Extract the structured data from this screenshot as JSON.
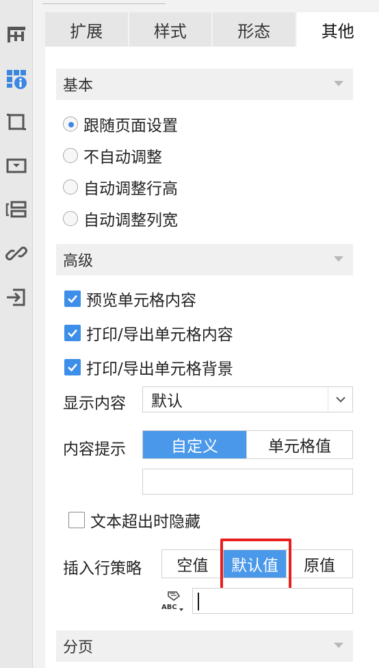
{
  "tabs": [
    {
      "label": "扩展"
    },
    {
      "label": "样式"
    },
    {
      "label": "形态"
    },
    {
      "label": "其他"
    }
  ],
  "sections": {
    "basic": "基本",
    "advanced": "高级",
    "pagination": "分页"
  },
  "basic_options": [
    {
      "label": "跟随页面设置",
      "checked": true
    },
    {
      "label": "不自动调整",
      "checked": false
    },
    {
      "label": "自动调整行高",
      "checked": false
    },
    {
      "label": "自动调整列宽",
      "checked": false
    }
  ],
  "advanced_checks": [
    {
      "label": "预览单元格内容",
      "checked": true
    },
    {
      "label": "打印/导出单元格内容",
      "checked": true
    },
    {
      "label": "打印/导出单元格背景",
      "checked": true
    }
  ],
  "display_content": {
    "label": "显示内容",
    "value": "默认"
  },
  "content_tip": {
    "label": "内容提示",
    "options": [
      "自定义",
      "单元格值"
    ],
    "selected": "自定义",
    "text_value": ""
  },
  "hide_overflow": {
    "label": "文本超出时隐藏",
    "checked": false
  },
  "insert_row_policy": {
    "label": "插入行策略",
    "options": [
      "空值",
      "默认值",
      "原值"
    ],
    "selected": "默认值",
    "formula_value": ""
  },
  "colors": {
    "accent": "#4a98ea",
    "highlight": "#e81f1f"
  }
}
